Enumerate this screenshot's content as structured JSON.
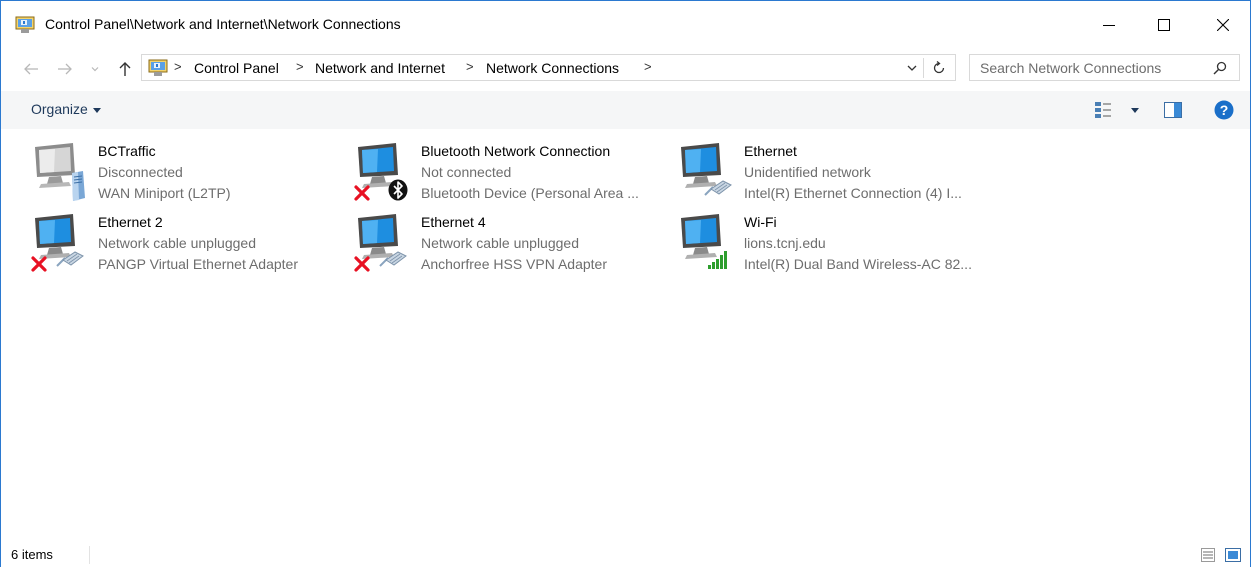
{
  "window": {
    "title": "Control Panel\\Network and Internet\\Network Connections"
  },
  "address": {
    "crumbs": [
      "Control Panel",
      "Network and Internet",
      "Network Connections"
    ],
    "separator": ">"
  },
  "search": {
    "placeholder": "Search Network Connections"
  },
  "toolbar": {
    "organize_label": "Organize"
  },
  "items": [
    {
      "name": "BCTraffic",
      "status": "Disconnected",
      "device": "WAN Miniport (L2TP)",
      "overlay": "server-icon"
    },
    {
      "name": "Bluetooth Network Connection",
      "status": "Not connected",
      "device": "Bluetooth Device (Personal Area ...",
      "overlay": "bluetooth-icon"
    },
    {
      "name": "Ethernet",
      "status": "Unidentified network",
      "device": "Intel(R) Ethernet Connection (4) I...",
      "overlay": "cable-icon"
    },
    {
      "name": "Ethernet 2",
      "status": "Network cable unplugged",
      "device": "PANGP Virtual Ethernet Adapter",
      "overlay": "cable-icon"
    },
    {
      "name": "Ethernet 4",
      "status": "Network cable unplugged",
      "device": "Anchorfree HSS VPN Adapter",
      "overlay": "cable-icon"
    },
    {
      "name": "Wi-Fi",
      "status": "lions.tcnj.edu",
      "device": "Intel(R) Dual Band Wireless-AC 82...",
      "overlay": "wifi-signal-icon"
    }
  ],
  "statusbar": {
    "item_count": "6 items"
  },
  "colors": {
    "accent": "#2b79d0",
    "command_bar": "#f5f6f7",
    "secondary_text": "#6d6d6d",
    "error_red": "#e81123",
    "signal_green": "#2e9e2e"
  }
}
